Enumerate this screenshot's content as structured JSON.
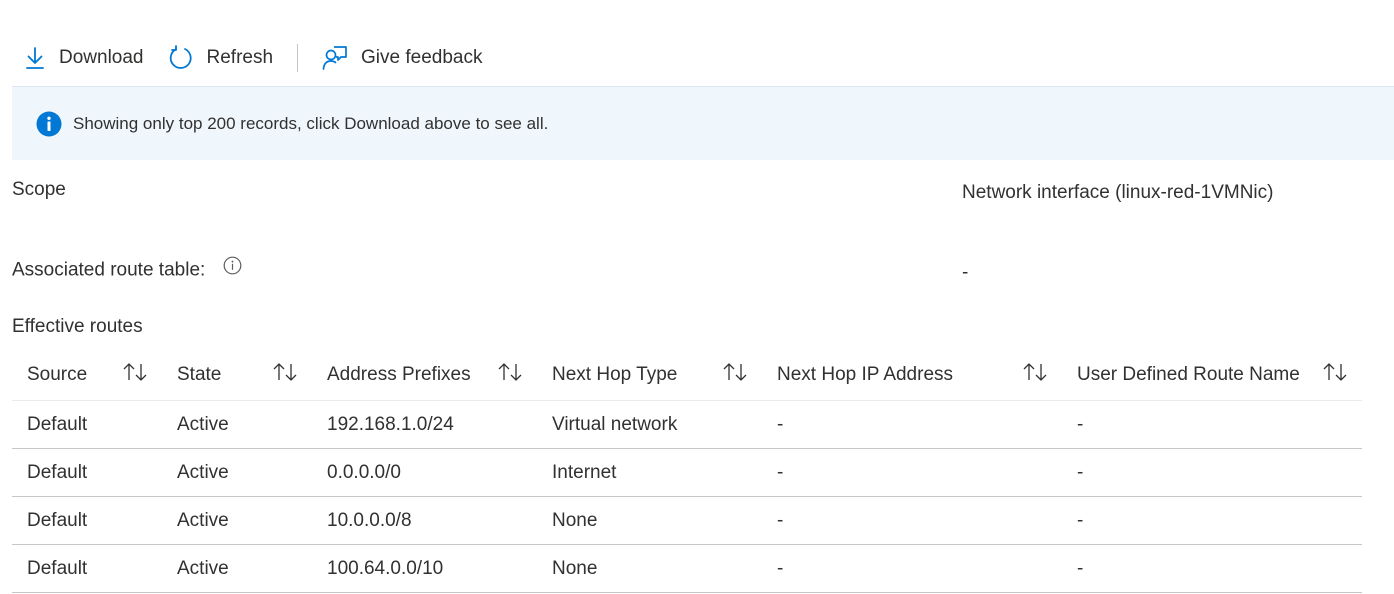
{
  "toolbar": {
    "download_label": "Download",
    "refresh_label": "Refresh",
    "feedback_label": "Give feedback"
  },
  "banner": {
    "message": "Showing only top 200 records, click Download above to see all."
  },
  "properties": {
    "scope_label": "Scope",
    "scope_value": "Network interface (linux-red-1VMNic)",
    "route_table_label": "Associated route table:",
    "route_table_value": "-"
  },
  "routes": {
    "title": "Effective routes",
    "columns": [
      "Source",
      "State",
      "Address Prefixes",
      "Next Hop Type",
      "Next Hop IP Address",
      "User Defined Route Name"
    ],
    "rows": [
      [
        "Default",
        "Active",
        "192.168.1.0/24",
        "Virtual network",
        "-",
        "-"
      ],
      [
        "Default",
        "Active",
        "0.0.0.0/0",
        "Internet",
        "-",
        "-"
      ],
      [
        "Default",
        "Active",
        "10.0.0.0/8",
        "None",
        "-",
        "-"
      ],
      [
        "Default",
        "Active",
        "100.64.0.0/10",
        "None",
        "-",
        "-"
      ]
    ]
  },
  "colors": {
    "accent": "#0078d4",
    "banner_bg": "#eff6fc",
    "text": "#323130",
    "divider": "#c8c6c4"
  },
  "icons": {
    "download": "download-icon",
    "refresh": "refresh-icon",
    "feedback": "feedback-icon",
    "info": "info-icon",
    "sort": "sort-icon"
  }
}
